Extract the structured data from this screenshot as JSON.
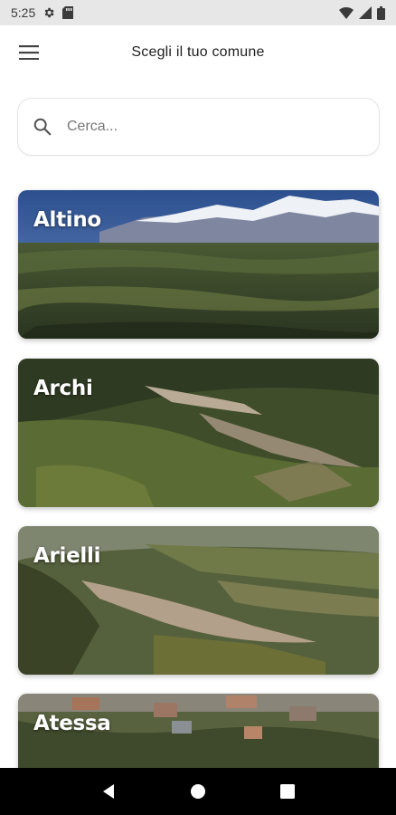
{
  "status_bar": {
    "time": "5:25"
  },
  "app_bar": {
    "title": "Scegli il tuo comune",
    "menu_icon": "menu-icon"
  },
  "search": {
    "placeholder": "Cerca...",
    "value": "",
    "icon": "search-icon"
  },
  "comuni": [
    {
      "name": "Altino"
    },
    {
      "name": "Archi"
    },
    {
      "name": "Arielli"
    },
    {
      "name": "Atessa"
    }
  ],
  "nav_bar": {
    "back_icon": "back-icon",
    "home_icon": "home-icon",
    "recents_icon": "recents-icon"
  }
}
